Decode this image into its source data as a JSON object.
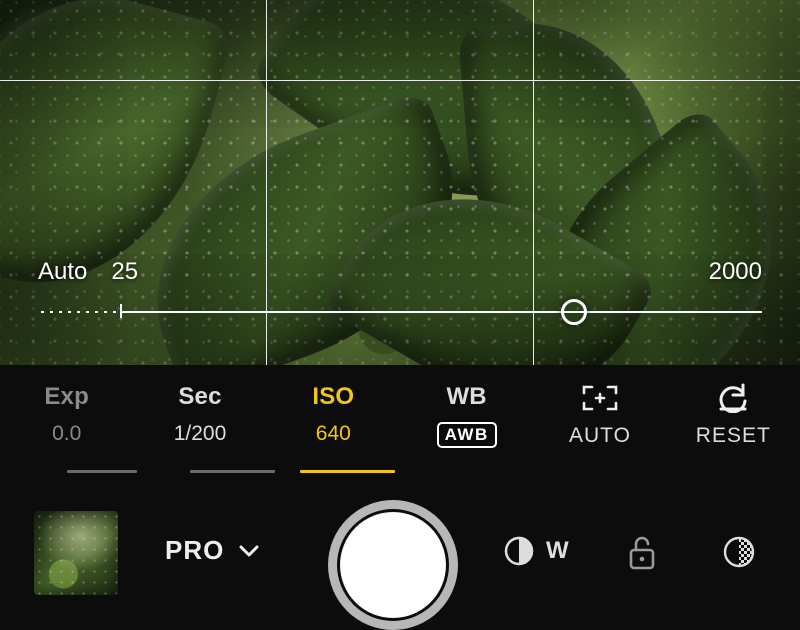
{
  "viewfinder": {
    "grid": true
  },
  "iso_slider": {
    "auto_label": "Auto",
    "min_label": "25",
    "max_label": "2000",
    "min": 25,
    "max": 2000,
    "current": 640,
    "auto_segment_fraction": 0.115,
    "thumb_fraction": 0.73
  },
  "params": {
    "exp": {
      "label": "Exp",
      "value": "0.0",
      "state": "dim"
    },
    "sec": {
      "label": "Sec",
      "value": "1/200",
      "state": "normal"
    },
    "iso": {
      "label": "ISO",
      "value": "640",
      "state": "active"
    },
    "wb": {
      "label": "WB",
      "value": "AWB",
      "state": "normal"
    },
    "focus": {
      "label": "[+]",
      "value": "AUTO",
      "state": "normal"
    },
    "reset": {
      "label": "↶",
      "value": "RESET",
      "state": "normal"
    }
  },
  "bottom": {
    "mode_label": "PRO",
    "lens_label": "W"
  },
  "colors": {
    "accent": "#f3c518",
    "muted": "#8a8a8a",
    "bg": "#0c0c0c"
  }
}
